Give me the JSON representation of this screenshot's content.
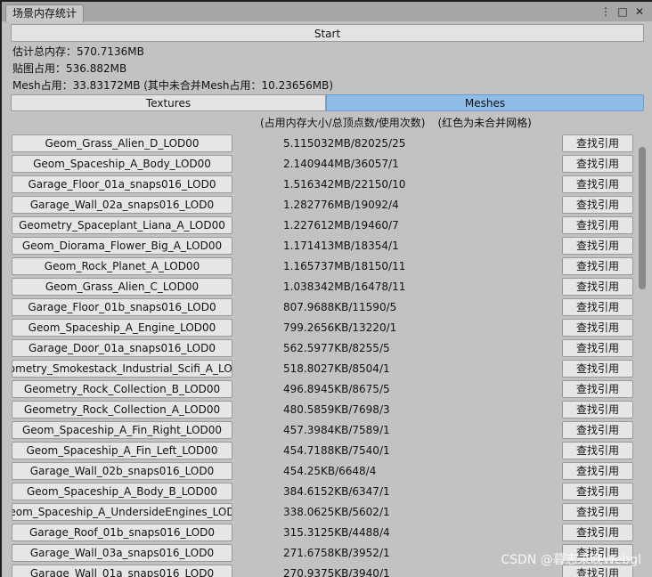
{
  "window": {
    "tab_title": "场景内存统计",
    "icons": [
      "more-icon",
      "maximize-icon",
      "close-icon"
    ]
  },
  "start_label": "Start",
  "stats": {
    "total": "估计总内存：570.7136MB",
    "texture": "贴图占用：536.882MB",
    "mesh": "Mesh占用：33.83172MB (其中未合并Mesh占用：10.23656MB)"
  },
  "tabs": {
    "textures": "Textures",
    "meshes": "Meshes"
  },
  "columns": {
    "usage": "(占用内存大小/总顶点数/使用次数)",
    "note": "(红色为未合并网格)"
  },
  "find_label": "查找引用",
  "rows": [
    {
      "name": "Geom_Grass_Alien_D_LOD00",
      "size": "5.115032MB/82025/25"
    },
    {
      "name": "Geom_Spaceship_A_Body_LOD00",
      "size": "2.140944MB/36057/1"
    },
    {
      "name": "Garage_Floor_01a_snaps016_LOD0",
      "size": "1.516342MB/22150/10"
    },
    {
      "name": "Garage_Wall_02a_snaps016_LOD0",
      "size": "1.282776MB/19092/4"
    },
    {
      "name": "Geometry_Spaceplant_Liana_A_LOD00",
      "size": "1.227612MB/19460/7"
    },
    {
      "name": "Geom_Diorama_Flower_Big_A_LOD00",
      "size": "1.171413MB/18354/1"
    },
    {
      "name": "Geom_Rock_Planet_A_LOD00",
      "size": "1.165737MB/18150/11"
    },
    {
      "name": "Geom_Grass_Alien_C_LOD00",
      "size": "1.038342MB/16478/11"
    },
    {
      "name": "Garage_Floor_01b_snaps016_LOD0",
      "size": "807.9688KB/11590/5"
    },
    {
      "name": "Geom_Spaceship_A_Engine_LOD00",
      "size": "799.2656KB/13220/1"
    },
    {
      "name": "Garage_Door_01a_snaps016_LOD0",
      "size": "562.5977KB/8255/5"
    },
    {
      "name": "ometry_Smokestack_Industrial_Scifi_A_LOI",
      "size": "518.8027KB/8504/1"
    },
    {
      "name": "Geometry_Rock_Collection_B_LOD00",
      "size": "496.8945KB/8675/5"
    },
    {
      "name": "Geometry_Rock_Collection_A_LOD00",
      "size": "480.5859KB/7698/3"
    },
    {
      "name": "Geom_Spaceship_A_Fin_Right_LOD00",
      "size": "457.3984KB/7589/1"
    },
    {
      "name": "Geom_Spaceship_A_Fin_Left_LOD00",
      "size": "454.7188KB/7540/1"
    },
    {
      "name": "Garage_Wall_02b_snaps016_LOD0",
      "size": "454.25KB/6648/4"
    },
    {
      "name": "Geom_Spaceship_A_Body_B_LOD00",
      "size": "384.6152KB/6347/1"
    },
    {
      "name": "eom_Spaceship_A_UndersideEngines_LOD",
      "size": "338.0625KB/5602/1"
    },
    {
      "name": "Garage_Roof_01b_snaps016_LOD0",
      "size": "315.3125KB/4488/4"
    },
    {
      "name": "Garage_Wall_03a_snaps016_LOD0",
      "size": "271.6758KB/3952/1"
    },
    {
      "name": "Garage_Wall_01a_snaps016_LOD0",
      "size": "270.9375KB/3940/1"
    }
  ],
  "watermark": "CSDN @暮志未晚Webgl"
}
